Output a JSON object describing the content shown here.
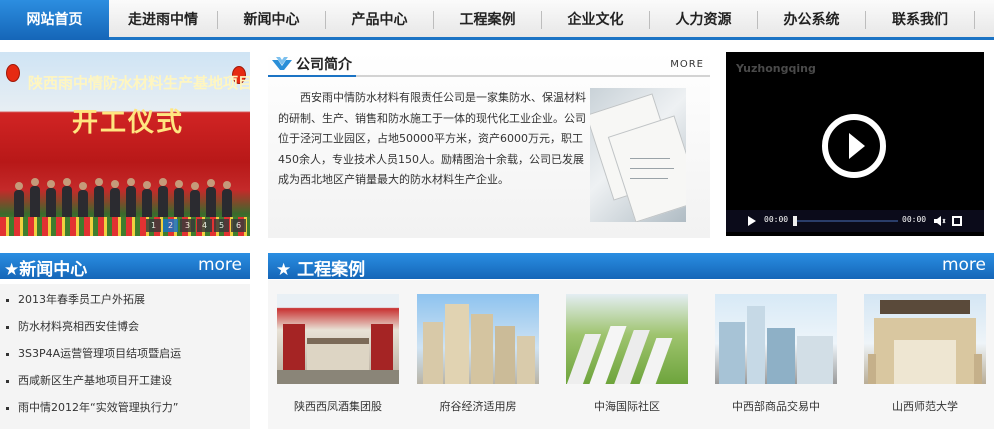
{
  "colors": {
    "brand_blue": "#1b73c4",
    "nav_active": "#1f7fd4",
    "bar_blue": "#1a73c8"
  },
  "nav": {
    "items": [
      {
        "label": "网站首页",
        "active": true
      },
      {
        "label": "走进雨中情"
      },
      {
        "label": "新闻中心"
      },
      {
        "label": "产品中心"
      },
      {
        "label": "工程案例"
      },
      {
        "label": "企业文化"
      },
      {
        "label": "人力资源"
      },
      {
        "label": "办公系统"
      },
      {
        "label": "联系我们"
      }
    ]
  },
  "banner": {
    "title": "陕西雨中情防水材料生产基地项目",
    "subtitle": "开工仪式",
    "dots": [
      "1",
      "2",
      "3",
      "4",
      "5",
      "6"
    ],
    "active_dot": 2
  },
  "about": {
    "title": "公司简介",
    "more": "MORE",
    "text": "西安雨中情防水材料有限责任公司是一家集防水、保温材料的研制、生产、销售和防水施工于一体的现代化工业企业。公司位于泾河工业园区，占地50000平方米，资产6000万元，职工450余人，专业技术人员150人。励精图治十余载，公司已发展成为西北地区产销量最大的防水材料生产企业。"
  },
  "video": {
    "watermark": "Yuzhongqing",
    "time_current": "00:00",
    "time_total": "00:00"
  },
  "news": {
    "title": "★新闻中心",
    "more": "more",
    "items": [
      "2013年春季员工户外拓展",
      "防水材料亮相西安佳博会",
      "3S3P4A运营管理项目结项暨启运",
      "西咸新区生产基地项目开工建设",
      "雨中情2012年“实效管理执行力”"
    ]
  },
  "cases": {
    "title": "★ 工程案例",
    "more": "more",
    "items": [
      "陕西西凤酒集团股",
      "府谷经济适用房",
      "中海国际社区",
      "中西部商品交易中",
      "山西师范大学"
    ]
  }
}
